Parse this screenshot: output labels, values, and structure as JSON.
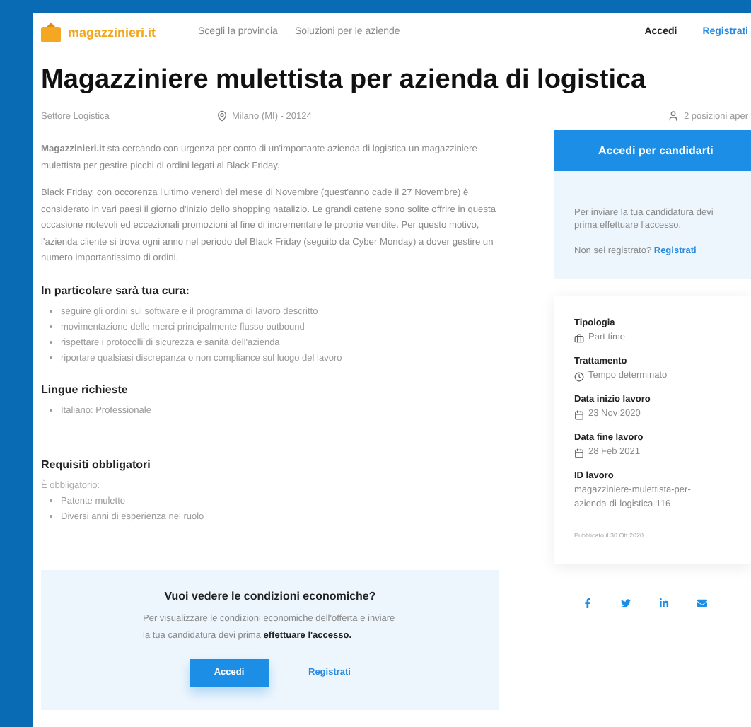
{
  "header": {
    "logo": "magazzinieri.it",
    "nav": [
      "Scegli la provincia",
      "Soluzioni per le aziende"
    ],
    "login": "Accedi",
    "register": "Registrati"
  },
  "job": {
    "title": "Magazziniere mulettista per azienda di logistica",
    "sector": "Settore Logistica",
    "location": "Milano (MI) - 20124",
    "positions": "2 posizioni aper"
  },
  "description": [
    "**Magazzinieri.it** sta cercando con urgenza per conto di un'importante azienda di logistica un magazziniere mulettista per gestire picchi di ordini legati al Black Friday.",
    "Black Friday, con occorenza l'ultimo venerdì del mese di Novembre (quest'anno cade il 27 Novembre) è considerato in vari paesi il giorno d'inizio dello shopping natalizio. Le grandi catene sono solite offrire in questa occasione notevoli ed eccezionali promozioni al fine di incrementare le proprie vendite. Per questo motivo, l'azienda cliente si trova ogni anno nel periodo del Black Friday (seguito da Cyber Monday) a dover gestire un numero importantissimo di ordini."
  ],
  "sections": [
    {
      "heading": "In particolare sarà tua cura:",
      "items": [
        "seguire gli ordini sul software e il programma di lavoro descritto",
        "movimentazione delle merci principalmente flusso outbound",
        "rispettare i protocolli di sicurezza e sanità dell'azienda",
        "riportare qualsiasi discrepanza o non compliance sul luogo del lavoro"
      ]
    },
    {
      "heading": "Lingue richieste",
      "items": [
        "Italiano: Professionale"
      ]
    },
    {
      "heading": "Requisiti obbligatori",
      "intro": "È obbligatorio:",
      "items": [
        "Patente muletto",
        "Diversi anni di esperienza nel ruolo"
      ]
    }
  ],
  "conditions_box": {
    "title": "Vuoi vedere le condizioni economiche?",
    "text": "Per visualizzare le condizioni economiche dell'offerta e inviare la tua candidatura devi prima **effettuare l'accesso.**",
    "login": "Accedi",
    "register": "Registrati"
  },
  "apply": {
    "button": "Accedi per candidarti",
    "text": "Per inviare la tua candidatura devi prima effettuare l'accesso.",
    "question": "Non sei registrato?",
    "register": "Registrati"
  },
  "details": [
    {
      "label": "Tipologia",
      "value": "Part time"
    },
    {
      "label": "Trattamento",
      "value": "Tempo determinato"
    },
    {
      "label": "Data inizio lavoro",
      "value": "23 Nov 2020"
    },
    {
      "label": "Data fine lavoro",
      "value": "28 Feb 2021"
    },
    {
      "label": "ID lavoro",
      "value": "magazziniere-mulettista-per-azienda-di-logistica-116"
    }
  ],
  "published": "Pubblicato il 30 Ott 2020"
}
